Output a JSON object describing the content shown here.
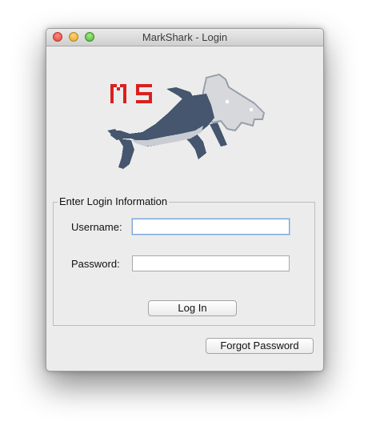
{
  "window": {
    "title": "MarkShark - Login"
  },
  "logo": {
    "text": "MS",
    "icon": "shark-logo-icon"
  },
  "login_group": {
    "title": "Enter Login Information",
    "username_label": "Username:",
    "username_value": "",
    "password_label": "Password:",
    "password_value": "",
    "login_button": "Log In"
  },
  "forgot_password_button": "Forgot Password",
  "colors": {
    "logo_text": "#d92020",
    "shark_body": "#45566e",
    "shark_head": "#d6d8dc",
    "shark_outline": "#98a0aa"
  }
}
